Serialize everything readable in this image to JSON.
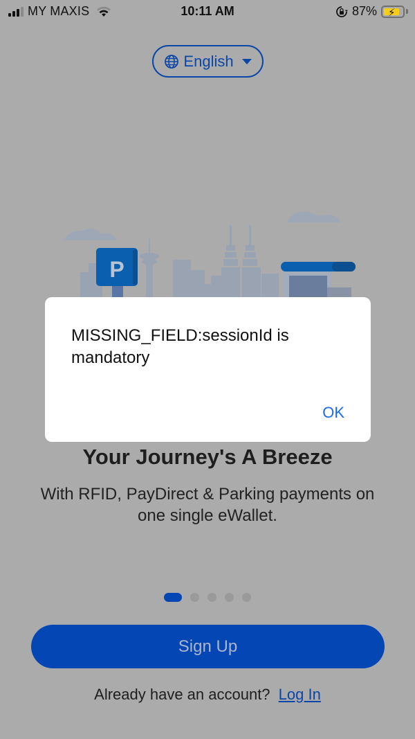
{
  "status_bar": {
    "carrier": "MY MAXIS",
    "time": "10:11 AM",
    "battery_percent_label": "87%",
    "battery_level": 0.87,
    "charging": true,
    "icons": [
      "signal-icon",
      "wifi-icon",
      "orientation-lock-icon",
      "battery-icon"
    ]
  },
  "language_selector": {
    "label": "English",
    "icon": "globe-icon"
  },
  "illustration": {
    "parking_sign_letter": "P",
    "colors": {
      "brand_blue": "#0a5fae",
      "skyline": "#9aa3b2",
      "cloud": "#9ea7b6"
    }
  },
  "onboarding": {
    "title": "Your Journey's A Breeze",
    "subtitle": "With RFID, PayDirect & Parking payments on one single eWallet.",
    "pager": {
      "total": 5,
      "active_index": 0
    }
  },
  "actions": {
    "signup_label": "Sign Up",
    "login_prompt": "Already have an account?",
    "login_label": "Log In"
  },
  "alert": {
    "message": "MISSING_FIELD:sessionId is mandatory",
    "ok_label": "OK"
  },
  "colors": {
    "accent": "#0546b5",
    "link": "#0a46a8",
    "alert_button": "#1a6be6",
    "overlay_bg": "#ababab"
  }
}
